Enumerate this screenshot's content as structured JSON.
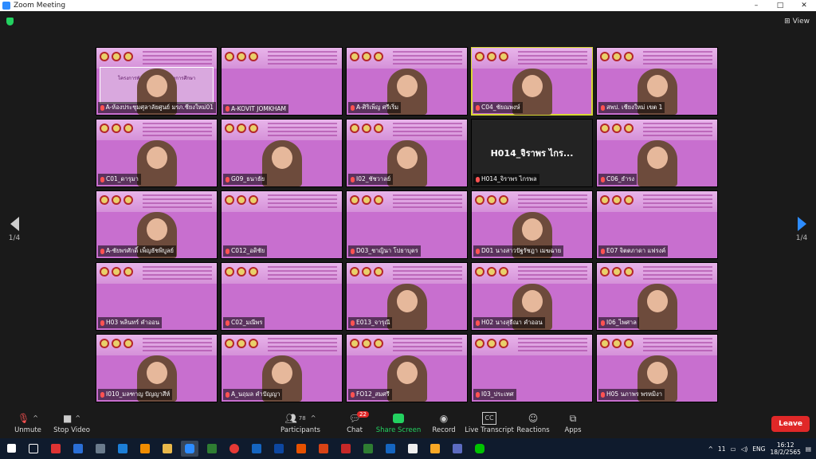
{
  "window": {
    "title": "Zoom Meeting",
    "view_label": "View"
  },
  "nav": {
    "left_page": "1/4",
    "right_page": "1/4"
  },
  "tiles": [
    {
      "name": "A-ห้องประชุมศุลาลัยศูนย์ มรภ.ชียงใหม่01",
      "muted": true,
      "slide": "โครงการพัฒนาบุคลากรทางการศึกษา"
    },
    {
      "name": "A-KOVIT JOMKHAM",
      "muted": true
    },
    {
      "name": "A-ศิริเพ็ญ ศรีเริ่ม",
      "muted": true
    },
    {
      "name": "C04_ชัยณพงษ์",
      "muted": true
    },
    {
      "name": "สพป. เชียงใหม่ เขต 1",
      "muted": true
    },
    {
      "name": "C01_ดารุมา",
      "muted": true
    },
    {
      "name": "G09_ธนาธัย",
      "muted": true
    },
    {
      "name": "I02_ชัชวาลย์",
      "muted": true
    },
    {
      "name": "H014_จิราพร ไกรพล",
      "muted": true,
      "center": "H014_จิราพร ไกร..."
    },
    {
      "name": "C06_ธำรง",
      "muted": true
    },
    {
      "name": "A-ชัยพรศักดิ์ เพ็ญธัชพิบูลย์",
      "muted": true
    },
    {
      "name": "C012_อดิชัย",
      "muted": true
    },
    {
      "name": "D03_ชาญินา โปธาบุตร",
      "muted": true
    },
    {
      "name": "D01 นางสาวปัฐรัชฎา เมฆฉาย",
      "muted": true
    },
    {
      "name": "E07 จิตตภาดา แฟรงค์",
      "muted": true
    },
    {
      "name": "H03 พลินทร์ คำออน",
      "muted": true
    },
    {
      "name": "C02_มณีพร",
      "muted": true
    },
    {
      "name": "E013_จารุณี",
      "muted": true
    },
    {
      "name": "H02 นางสุธีณา คำออน",
      "muted": true
    },
    {
      "name": "I06_ไพศาล",
      "muted": true
    },
    {
      "name": "I010_มลฑาญ ปัญญาสีห์",
      "muted": true
    },
    {
      "name": "A_นฤมล คำปัญญา",
      "muted": true
    },
    {
      "name": "FO12_สมศรี",
      "muted": true
    },
    {
      "name": "I03_ประเทศ",
      "muted": true
    },
    {
      "name": "H05 นภาพร พรหมิงา",
      "muted": true
    }
  ],
  "toolbar": {
    "unmute": "Unmute",
    "stop_video": "Stop Video",
    "participants": "Participants",
    "participants_count": "78",
    "chat": "Chat",
    "chat_badge": "22",
    "share": "Share Screen",
    "record": "Record",
    "transcript": "Live Transcript",
    "reactions": "Reactions",
    "apps": "Apps",
    "leave": "Leave"
  },
  "taskbar": {
    "lang": "ENG",
    "time": "16:12",
    "date": "18/2/2565",
    "notif": "11"
  },
  "colors": {
    "accent": "#2d8cff",
    "leave": "#e02828",
    "share": "#23d160",
    "tile_bg": "#c86fcf"
  }
}
